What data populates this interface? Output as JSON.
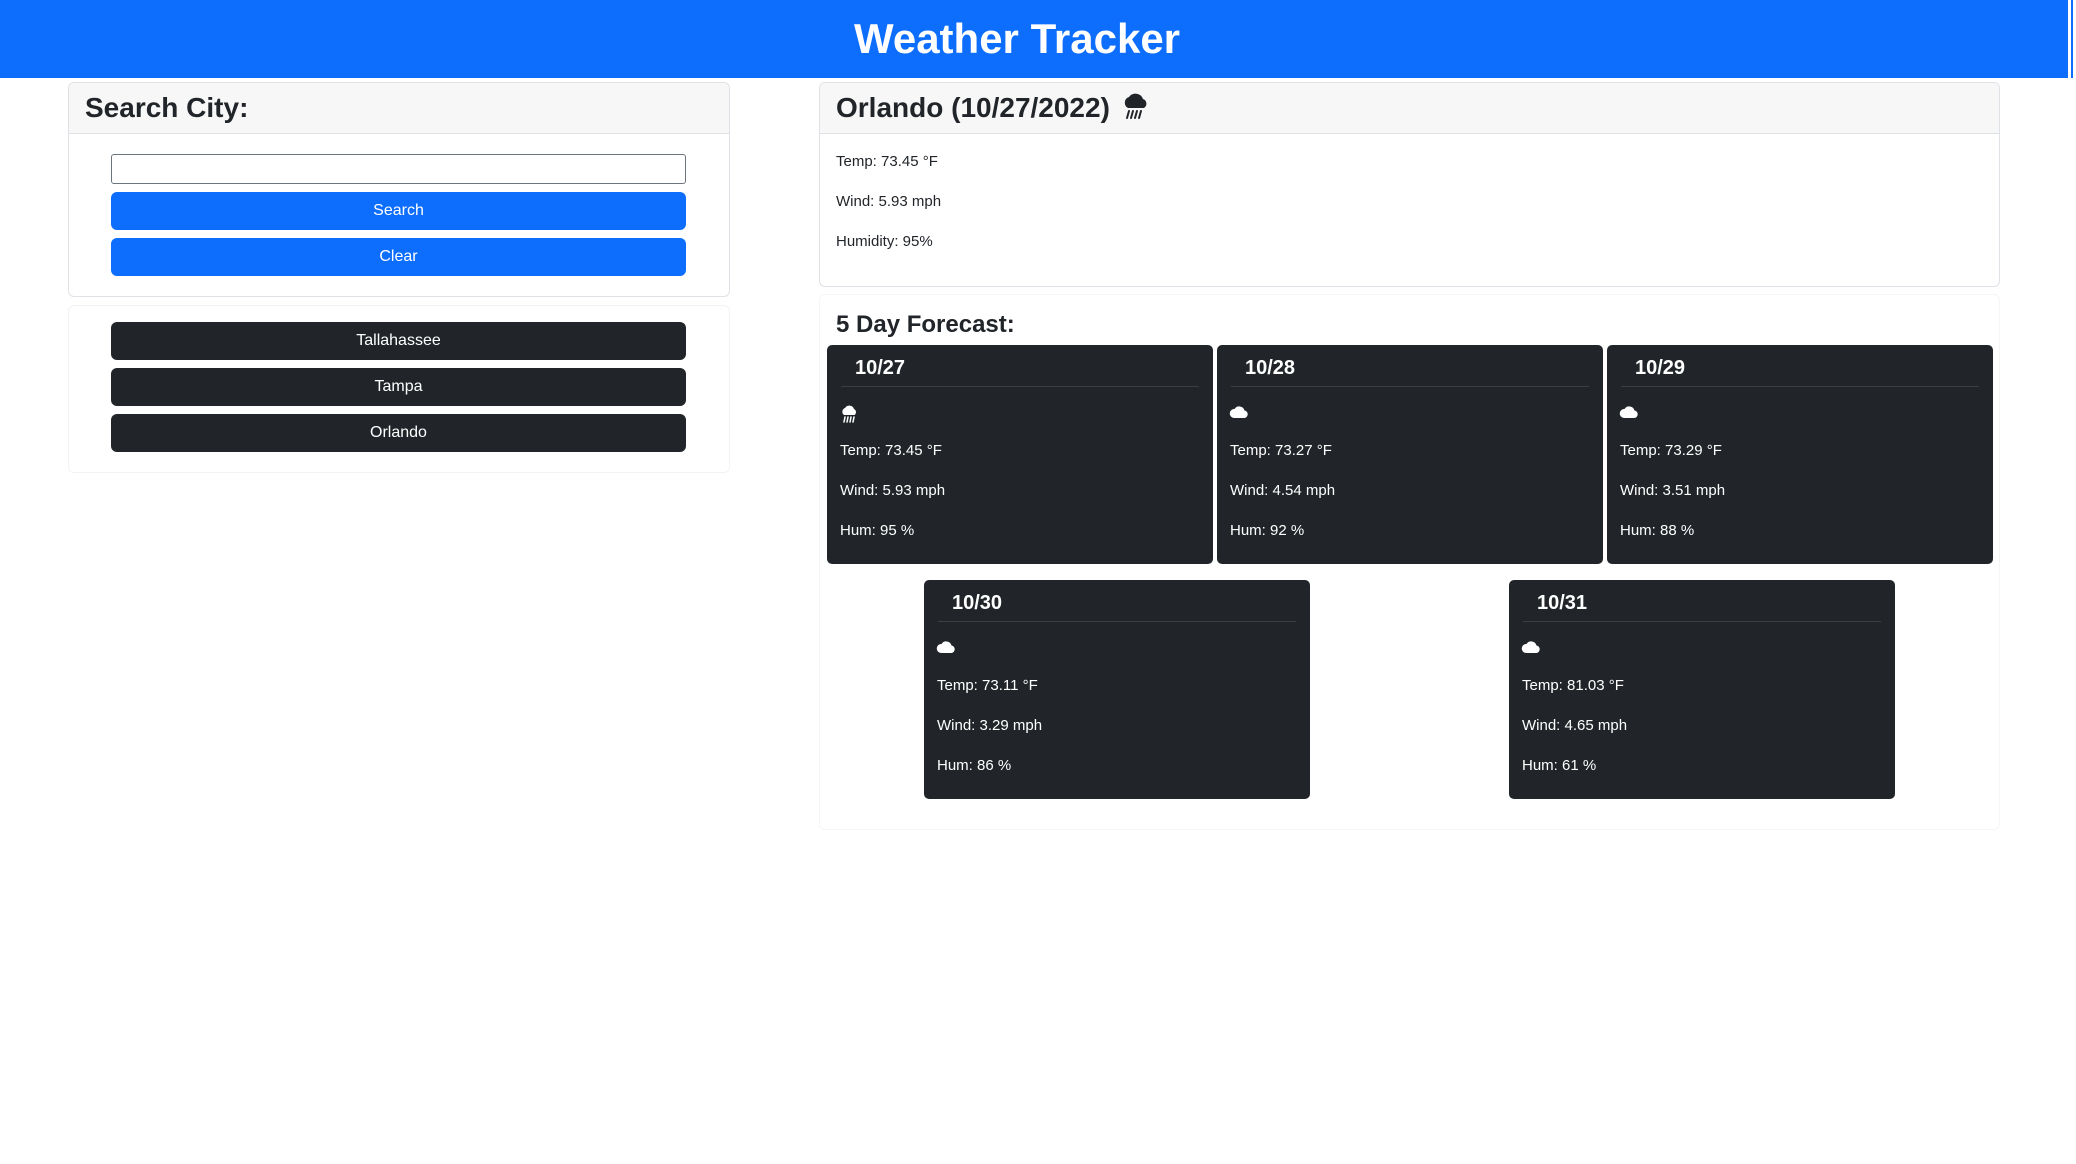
{
  "header": {
    "title": "Weather Tracker"
  },
  "search": {
    "heading": "Search City:",
    "input_value": "",
    "input_placeholder": "",
    "search_label": "Search",
    "clear_label": "Clear"
  },
  "history": [
    "Tallahassee",
    "Tampa",
    "Orlando"
  ],
  "current": {
    "title": "Orlando (10/27/2022)",
    "icon": "rain-cloud-icon",
    "temp": "Temp: 73.45 °F",
    "wind": "Wind: 5.93 mph",
    "humidity": "Humidity: 95%"
  },
  "forecast": {
    "title": "5 Day Forecast:",
    "days": [
      {
        "date": "10/27",
        "icon": "rain-cloud-icon",
        "temp": "Temp: 73.45 °F",
        "wind": "Wind: 5.93 mph",
        "hum": "Hum: 95 %"
      },
      {
        "date": "10/28",
        "icon": "cloud-icon",
        "temp": "Temp: 73.27 °F",
        "wind": "Wind: 4.54 mph",
        "hum": "Hum: 92 %"
      },
      {
        "date": "10/29",
        "icon": "cloud-icon",
        "temp": "Temp: 73.29 °F",
        "wind": "Wind: 3.51 mph",
        "hum": "Hum: 88 %"
      },
      {
        "date": "10/30",
        "icon": "cloud-icon",
        "temp": "Temp: 73.11 °F",
        "wind": "Wind: 3.29 mph",
        "hum": "Hum: 86 %"
      },
      {
        "date": "10/31",
        "icon": "cloud-icon",
        "temp": "Temp: 81.03 °F",
        "wind": "Wind: 4.65 mph",
        "hum": "Hum: 61 %"
      }
    ]
  },
  "colors": {
    "primary": "#0d6efd",
    "dark": "#212529",
    "card_header": "#f7f7f7"
  }
}
